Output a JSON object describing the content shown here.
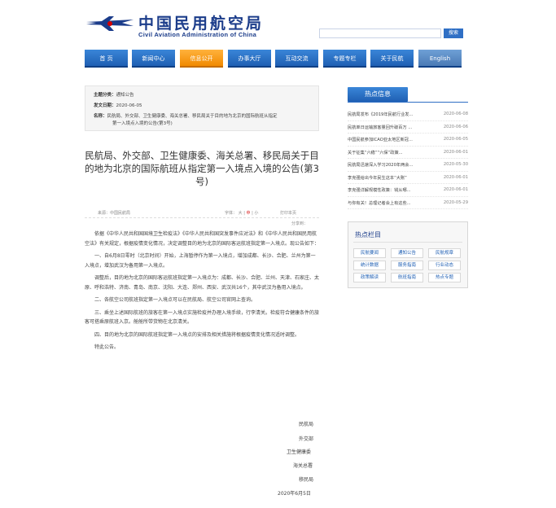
{
  "header": {
    "title_cn": "中国民用航空局",
    "title_en": "Civil Aviation Administration of China",
    "search_button": "搜索",
    "search_placeholder": ""
  },
  "nav": [
    "首 页",
    "新闻中心",
    "信息公开",
    "办事大厅",
    "互动交流",
    "专题专栏",
    "关于民航",
    "English"
  ],
  "nav_active_index": 2,
  "meta": {
    "subject_label": "主题分类：",
    "subject_value": "通知公告",
    "date_label": "发文日期：",
    "date_value": "2020-06-05",
    "name_label": "名称：",
    "name_value_line1": "民航局、外交部、卫生健康委、海关总署、移民局关于目的地为北京的国际航班从指定",
    "name_value_line2": "第一入境点入境的公告(第3号)"
  },
  "article": {
    "title": "民航局、外交部、卫生健康委、海关总署、移民局关于目的地为北京的国际航班从指定第一入境点入境的公告(第3号)",
    "source": "来源：中国民航局",
    "font_label": "字体：",
    "font_large": "大",
    "font_medium": "中",
    "font_small": "小",
    "print": "打印本页",
    "share": "分享到：",
    "paragraphs": [
      "依据《中华人民共和国国境卫生检疫法》《中华人民共和国突发事件应对法》和《中华人民共和国民用航空法》有关规定，根据疫情变化情况，决定调整目的地为北京的国际客运航班指定第一入境点。现公告如下：",
      "一、自6月8日零时（北京时间）开始，上海暂停作为第一入境点，增加成都、长沙、合肥、兰州为第一入境点，增加武汉为备用第一入境点。",
      "调整后，目的地为北京的国际客运航班指定第一入境点为：成都、长沙、合肥、兰州、天津、石家庄、太原、呼和浩特、济南、青岛、南京、沈阳、大连、郑州、西安、武汉共16个，其中武汉为备用入境点。",
      "二、各航空公司航班指定第一入境点可以在民航局、航空公司官网上查询。",
      "三、乘坐上述国际航班的旅客在第一入境点实施检疫并办理入境手续，行李清关。检疫符合健康条件的旅客可搭乘原航班入京。舱舱所带货物在北京清关。",
      "四、目的地为北京的国际航班指定第一入境点的安排及相关措施将根据疫情变化情况适时调整。",
      "特此公告。"
    ],
    "signatures": [
      "民航局",
      "外交部",
      "卫生健康委",
      "海关总署",
      "移民局",
      "2020年6月5日"
    ]
  },
  "hot": {
    "title": "热点信息",
    "items": [
      {
        "title": "民航局发布《2019年民航行业发...",
        "date": "2020-06-08"
      },
      {
        "title": "民航单日运输旅客量回升破百万 ...",
        "date": "2020-06-06"
      },
      {
        "title": "中国民航参加ICAO亚太地区新冠...",
        "date": "2020-06-05"
      },
      {
        "title": "关于征集“六稳”“六保”政策...",
        "date": "2020-06-01"
      },
      {
        "title": "民航局迅速深入学习2020年两会...",
        "date": "2020-05-30"
      },
      {
        "title": "李克强给出今年民生这本“大账”",
        "date": "2020-06-01"
      },
      {
        "title": "李克强详解规模性政策：钱从哪...",
        "date": "2020-06-01"
      },
      {
        "title": "与你有关！总理记者会上有这些...",
        "date": "2020-05-29"
      }
    ]
  },
  "columns": {
    "title": "热点栏目",
    "items": [
      "民航要闻",
      "通知公告",
      "民航规章",
      "统计数据",
      "服务指南",
      "行业动态",
      "政策解读",
      "航班指南",
      "热点专题"
    ]
  },
  "colors": {
    "brand_blue": "#1b3c8a",
    "nav_blue": "#2f6fc5",
    "nav_active": "#f18a00"
  }
}
